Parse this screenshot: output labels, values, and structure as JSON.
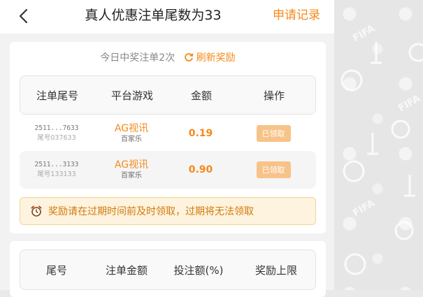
{
  "header": {
    "title": "真人优惠注单尾数为33",
    "apply_record": "申请记录"
  },
  "summary": {
    "text": "今日中奖注单2次",
    "refresh": "刷新奖励"
  },
  "table": {
    "headers": [
      "注单尾号",
      "平台游戏",
      "金额",
      "操作"
    ],
    "rows": [
      {
        "bet_id": "2511...7633",
        "tail": "尾号037633",
        "platform": "AG视讯",
        "game": "百家乐",
        "amount": "0.19",
        "action": "已领取"
      },
      {
        "bet_id": "2511...3133",
        "tail": "尾号133133",
        "platform": "AG视讯",
        "game": "百家乐",
        "amount": "0.90",
        "action": "已领取"
      }
    ]
  },
  "notice": {
    "text": "奖励请在过期时间前及时领取，过期将无法领取"
  },
  "rules_table": {
    "headers": [
      "尾号",
      "注单金额",
      "投注额(%)",
      "奖励上限"
    ]
  },
  "background": {
    "watermark": "FIFA"
  },
  "colors": {
    "accent": "#f5891a",
    "claimed_button": "#f7c389",
    "notice_bg": "#fdf3de"
  }
}
